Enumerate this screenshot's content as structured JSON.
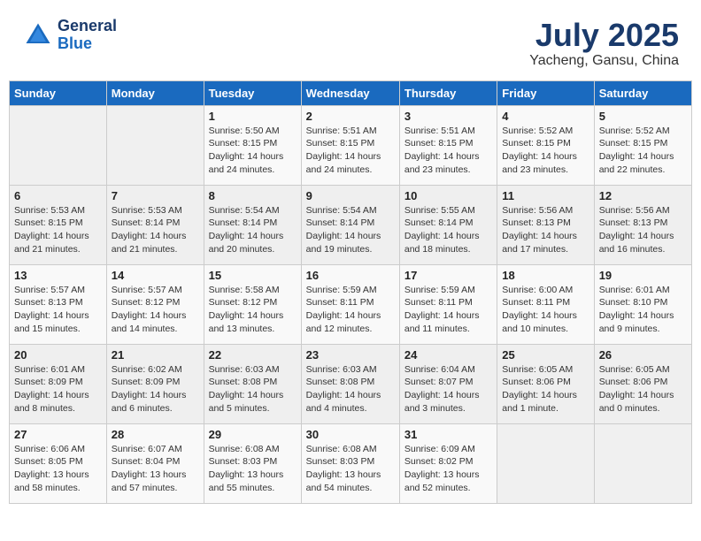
{
  "header": {
    "logo_general": "General",
    "logo_blue": "Blue",
    "month": "July 2025",
    "location": "Yacheng, Gansu, China"
  },
  "weekdays": [
    "Sunday",
    "Monday",
    "Tuesday",
    "Wednesday",
    "Thursday",
    "Friday",
    "Saturday"
  ],
  "weeks": [
    [
      {
        "day": "",
        "info": ""
      },
      {
        "day": "",
        "info": ""
      },
      {
        "day": "1",
        "info": "Sunrise: 5:50 AM\nSunset: 8:15 PM\nDaylight: 14 hours and 24 minutes."
      },
      {
        "day": "2",
        "info": "Sunrise: 5:51 AM\nSunset: 8:15 PM\nDaylight: 14 hours and 24 minutes."
      },
      {
        "day": "3",
        "info": "Sunrise: 5:51 AM\nSunset: 8:15 PM\nDaylight: 14 hours and 23 minutes."
      },
      {
        "day": "4",
        "info": "Sunrise: 5:52 AM\nSunset: 8:15 PM\nDaylight: 14 hours and 23 minutes."
      },
      {
        "day": "5",
        "info": "Sunrise: 5:52 AM\nSunset: 8:15 PM\nDaylight: 14 hours and 22 minutes."
      }
    ],
    [
      {
        "day": "6",
        "info": "Sunrise: 5:53 AM\nSunset: 8:15 PM\nDaylight: 14 hours and 21 minutes."
      },
      {
        "day": "7",
        "info": "Sunrise: 5:53 AM\nSunset: 8:14 PM\nDaylight: 14 hours and 21 minutes."
      },
      {
        "day": "8",
        "info": "Sunrise: 5:54 AM\nSunset: 8:14 PM\nDaylight: 14 hours and 20 minutes."
      },
      {
        "day": "9",
        "info": "Sunrise: 5:54 AM\nSunset: 8:14 PM\nDaylight: 14 hours and 19 minutes."
      },
      {
        "day": "10",
        "info": "Sunrise: 5:55 AM\nSunset: 8:14 PM\nDaylight: 14 hours and 18 minutes."
      },
      {
        "day": "11",
        "info": "Sunrise: 5:56 AM\nSunset: 8:13 PM\nDaylight: 14 hours and 17 minutes."
      },
      {
        "day": "12",
        "info": "Sunrise: 5:56 AM\nSunset: 8:13 PM\nDaylight: 14 hours and 16 minutes."
      }
    ],
    [
      {
        "day": "13",
        "info": "Sunrise: 5:57 AM\nSunset: 8:13 PM\nDaylight: 14 hours and 15 minutes."
      },
      {
        "day": "14",
        "info": "Sunrise: 5:57 AM\nSunset: 8:12 PM\nDaylight: 14 hours and 14 minutes."
      },
      {
        "day": "15",
        "info": "Sunrise: 5:58 AM\nSunset: 8:12 PM\nDaylight: 14 hours and 13 minutes."
      },
      {
        "day": "16",
        "info": "Sunrise: 5:59 AM\nSunset: 8:11 PM\nDaylight: 14 hours and 12 minutes."
      },
      {
        "day": "17",
        "info": "Sunrise: 5:59 AM\nSunset: 8:11 PM\nDaylight: 14 hours and 11 minutes."
      },
      {
        "day": "18",
        "info": "Sunrise: 6:00 AM\nSunset: 8:11 PM\nDaylight: 14 hours and 10 minutes."
      },
      {
        "day": "19",
        "info": "Sunrise: 6:01 AM\nSunset: 8:10 PM\nDaylight: 14 hours and 9 minutes."
      }
    ],
    [
      {
        "day": "20",
        "info": "Sunrise: 6:01 AM\nSunset: 8:09 PM\nDaylight: 14 hours and 8 minutes."
      },
      {
        "day": "21",
        "info": "Sunrise: 6:02 AM\nSunset: 8:09 PM\nDaylight: 14 hours and 6 minutes."
      },
      {
        "day": "22",
        "info": "Sunrise: 6:03 AM\nSunset: 8:08 PM\nDaylight: 14 hours and 5 minutes."
      },
      {
        "day": "23",
        "info": "Sunrise: 6:03 AM\nSunset: 8:08 PM\nDaylight: 14 hours and 4 minutes."
      },
      {
        "day": "24",
        "info": "Sunrise: 6:04 AM\nSunset: 8:07 PM\nDaylight: 14 hours and 3 minutes."
      },
      {
        "day": "25",
        "info": "Sunrise: 6:05 AM\nSunset: 8:06 PM\nDaylight: 14 hours and 1 minute."
      },
      {
        "day": "26",
        "info": "Sunrise: 6:05 AM\nSunset: 8:06 PM\nDaylight: 14 hours and 0 minutes."
      }
    ],
    [
      {
        "day": "27",
        "info": "Sunrise: 6:06 AM\nSunset: 8:05 PM\nDaylight: 13 hours and 58 minutes."
      },
      {
        "day": "28",
        "info": "Sunrise: 6:07 AM\nSunset: 8:04 PM\nDaylight: 13 hours and 57 minutes."
      },
      {
        "day": "29",
        "info": "Sunrise: 6:08 AM\nSunset: 8:03 PM\nDaylight: 13 hours and 55 minutes."
      },
      {
        "day": "30",
        "info": "Sunrise: 6:08 AM\nSunset: 8:03 PM\nDaylight: 13 hours and 54 minutes."
      },
      {
        "day": "31",
        "info": "Sunrise: 6:09 AM\nSunset: 8:02 PM\nDaylight: 13 hours and 52 minutes."
      },
      {
        "day": "",
        "info": ""
      },
      {
        "day": "",
        "info": ""
      }
    ]
  ]
}
